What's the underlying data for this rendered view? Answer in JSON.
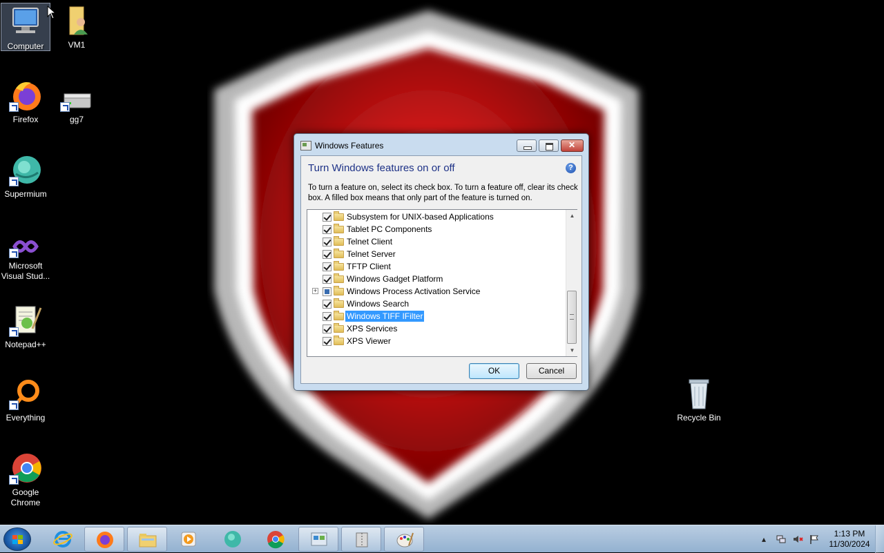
{
  "desktop": {
    "icons": [
      {
        "label": "Computer",
        "name": "computer-icon"
      },
      {
        "label": "VM1",
        "name": "user-folder-icon"
      },
      {
        "label": "Firefox",
        "name": "firefox-icon"
      },
      {
        "label": "gg7",
        "name": "drive-icon"
      },
      {
        "label": "Supermium",
        "name": "supermium-icon"
      },
      {
        "label": "Microsoft Visual Stud...",
        "name": "visual-studio-icon"
      },
      {
        "label": "Notepad++",
        "name": "notepadpp-icon"
      },
      {
        "label": "Everything",
        "name": "everything-icon"
      },
      {
        "label": "Google Chrome",
        "name": "chrome-icon"
      },
      {
        "label": "Recycle Bin",
        "name": "recycle-bin-icon"
      }
    ]
  },
  "dialog": {
    "title": "Windows Features",
    "heading": "Turn Windows features on or off",
    "description": "To turn a feature on, select its check box. To turn a feature off, clear its check box. A filled box means that only part of the feature is turned on.",
    "features": [
      {
        "label": "Subsystem for UNIX-based Applications",
        "state": "checked"
      },
      {
        "label": "Tablet PC Components",
        "state": "checked"
      },
      {
        "label": "Telnet Client",
        "state": "checked"
      },
      {
        "label": "Telnet Server",
        "state": "checked"
      },
      {
        "label": "TFTP Client",
        "state": "checked"
      },
      {
        "label": "Windows Gadget Platform",
        "state": "checked"
      },
      {
        "label": "Windows Process Activation Service",
        "state": "partial",
        "expandable": true
      },
      {
        "label": "Windows Search",
        "state": "checked"
      },
      {
        "label": "Windows TIFF IFilter",
        "state": "checked",
        "selected": true
      },
      {
        "label": "XPS Services",
        "state": "checked"
      },
      {
        "label": "XPS Viewer",
        "state": "checked"
      }
    ],
    "ok_label": "OK",
    "cancel_label": "Cancel",
    "help_glyph": "?"
  },
  "taskbar": {
    "items": [
      "start-button",
      "internet-explorer",
      "firefox",
      "windows-explorer",
      "media-player",
      "supermium",
      "chrome",
      "windows-features",
      "archive-tool",
      "paint"
    ],
    "clock_time": "1:13 PM",
    "clock_date": "11/30/2024"
  },
  "colors": {
    "selection": "#3399ff",
    "heading": "#1e3287",
    "shield_red": "#d01010"
  }
}
